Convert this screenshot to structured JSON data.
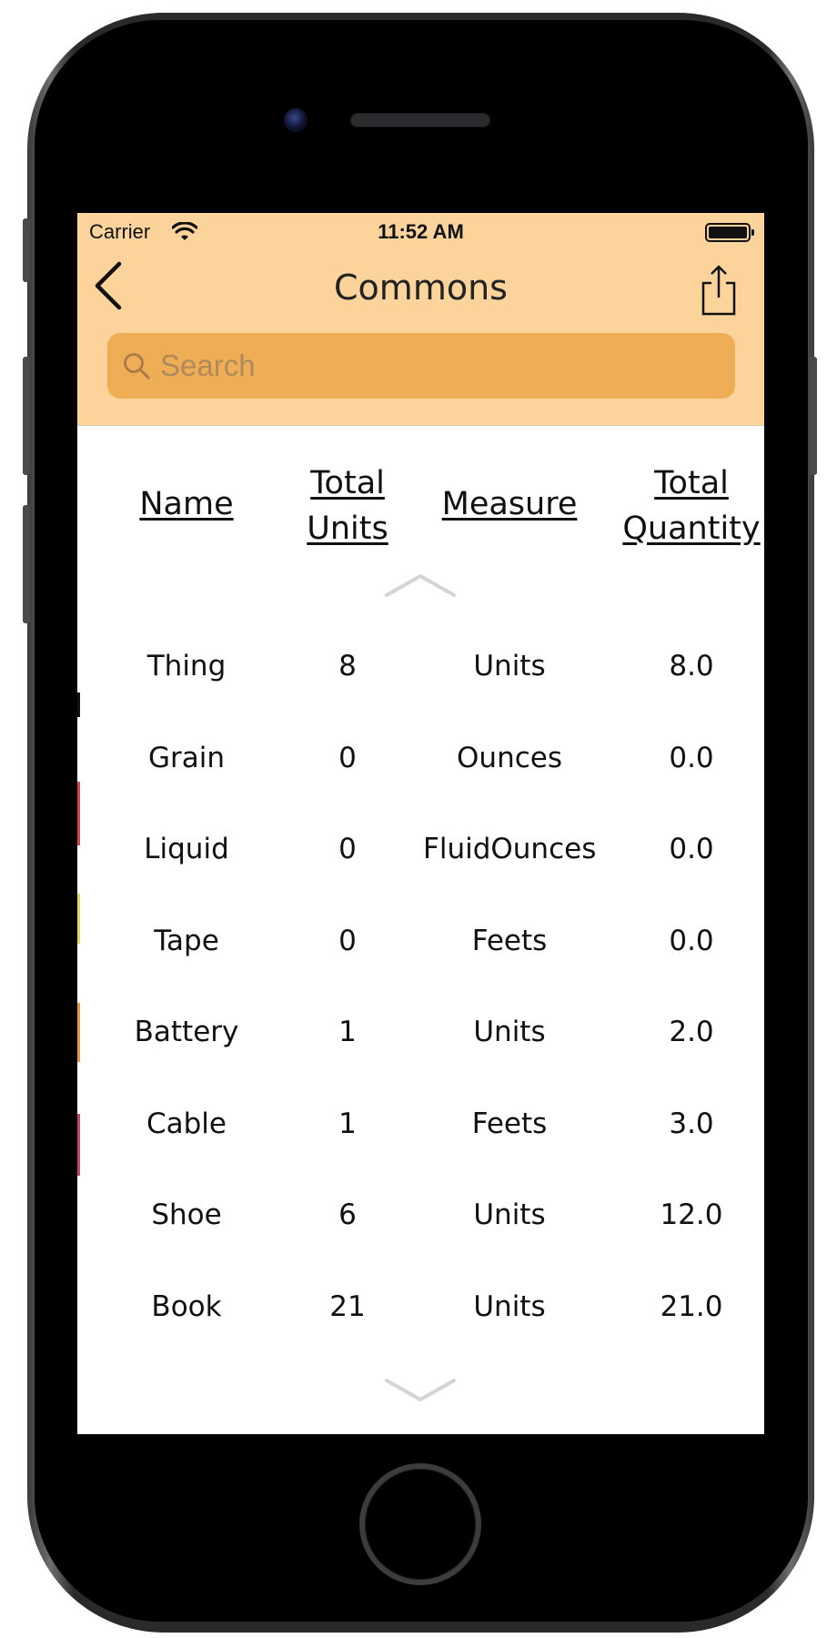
{
  "status_bar": {
    "carrier": "Carrier",
    "time": "11:52 AM"
  },
  "nav": {
    "title": "Commons",
    "back_icon": "chevron-left-icon",
    "share_icon": "share-icon"
  },
  "search": {
    "placeholder": "Search"
  },
  "table": {
    "headers": {
      "name": "Name",
      "total_units": "Total Units",
      "measure": "Measure",
      "total_quantity": "Total Quantity"
    },
    "rows": [
      {
        "name": "Thing",
        "total_units": "8",
        "measure": "Units",
        "total_quantity": "8.0"
      },
      {
        "name": "Grain",
        "total_units": "0",
        "measure": "Ounces",
        "total_quantity": "0.0"
      },
      {
        "name": "Liquid",
        "total_units": "0",
        "measure": "FluidOunces",
        "total_quantity": "0.0"
      },
      {
        "name": "Tape",
        "total_units": "0",
        "measure": "Feets",
        "total_quantity": "0.0"
      },
      {
        "name": "Battery",
        "total_units": "1",
        "measure": "Units",
        "total_quantity": "2.0"
      },
      {
        "name": "Cable",
        "total_units": "1",
        "measure": "Feets",
        "total_quantity": "3.0"
      },
      {
        "name": "Shoe",
        "total_units": "6",
        "measure": "Units",
        "total_quantity": "12.0"
      },
      {
        "name": "Book",
        "total_units": "21",
        "measure": "Units",
        "total_quantity": "21.0"
      }
    ]
  },
  "colors": {
    "nav_background": "#fcd49b",
    "search_background": "#efad55"
  }
}
